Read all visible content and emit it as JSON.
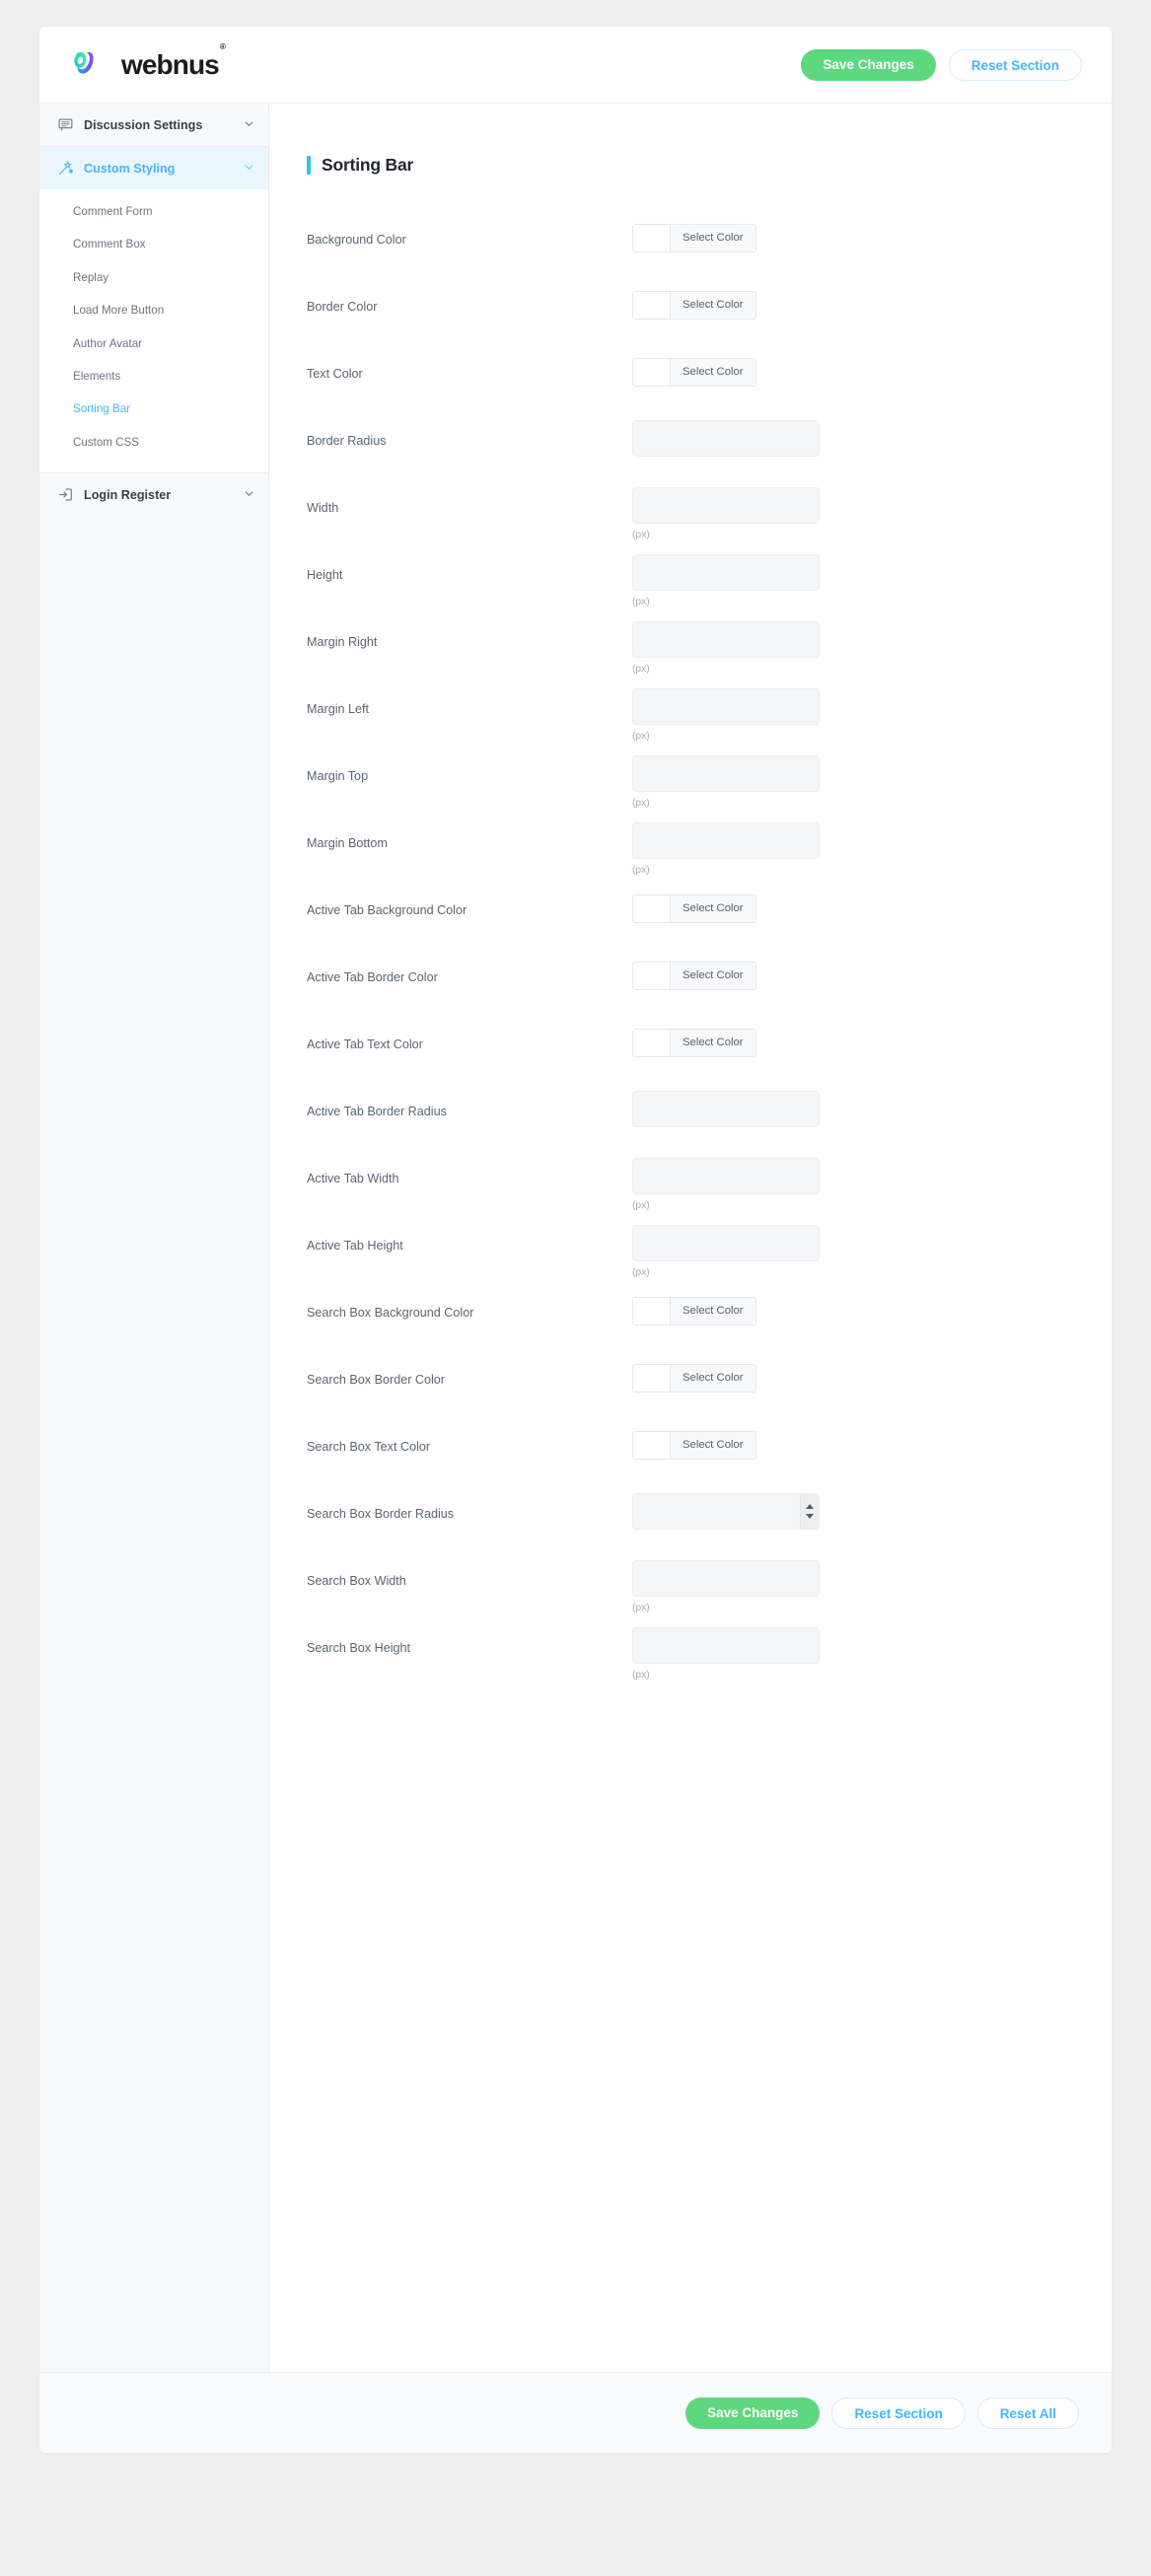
{
  "header": {
    "brand_name": "webnus",
    "brand_mark_icon": "webnus-logo-icon",
    "registered_mark": "®",
    "save_label": "Save Changes",
    "reset_section_label": "Reset Section"
  },
  "sidebar": {
    "groups": [
      {
        "label": "Discussion Settings",
        "icon": "comment-icon",
        "active": false,
        "items": []
      },
      {
        "label": "Custom Styling",
        "icon": "magic-wand-icon",
        "active": true,
        "items": [
          {
            "label": "Comment Form",
            "active": false
          },
          {
            "label": "Comment Box",
            "active": false
          },
          {
            "label": "Replay",
            "active": false
          },
          {
            "label": "Load More Button",
            "active": false
          },
          {
            "label": "Author Avatar",
            "active": false
          },
          {
            "label": "Elements",
            "active": false
          },
          {
            "label": "Sorting Bar",
            "active": true
          },
          {
            "label": "Custom CSS",
            "active": false
          }
        ]
      },
      {
        "label": "Login Register",
        "icon": "login-icon",
        "active": false,
        "items": []
      }
    ]
  },
  "main": {
    "section_title": "Sorting Bar",
    "accent_color": "#2ec3ef",
    "color_button_label": "Select Color",
    "unit_label": "(px)",
    "input_value": "",
    "input_placeholder": "",
    "fields": [
      {
        "label": "Background Color",
        "type": "color"
      },
      {
        "label": "Border Color",
        "type": "color"
      },
      {
        "label": "Text Color",
        "type": "color"
      },
      {
        "label": "Border Radius",
        "type": "text"
      },
      {
        "label": "Width",
        "type": "text",
        "unit": "(px)"
      },
      {
        "label": "Height",
        "type": "text",
        "unit": "(px)"
      },
      {
        "label": "Margin Right",
        "type": "text",
        "unit": "(px)"
      },
      {
        "label": "Margin Left",
        "type": "text",
        "unit": "(px)"
      },
      {
        "label": "Margin Top",
        "type": "text",
        "unit": "(px)"
      },
      {
        "label": "Margin Bottom",
        "type": "text",
        "unit": "(px)"
      },
      {
        "label": "Active Tab Background Color",
        "type": "color"
      },
      {
        "label": "Active Tab Border Color",
        "type": "color"
      },
      {
        "label": "Active Tab Text Color",
        "type": "color"
      },
      {
        "label": "Active Tab Border Radius",
        "type": "text"
      },
      {
        "label": "Active Tab Width",
        "type": "text",
        "unit": "(px)"
      },
      {
        "label": "Active Tab Height",
        "type": "text",
        "unit": "(px)"
      },
      {
        "label": "Search Box Background Color",
        "type": "color"
      },
      {
        "label": "Search Box Border Color",
        "type": "color"
      },
      {
        "label": "Search Box Text Color",
        "type": "color"
      },
      {
        "label": "Search Box Border Radius",
        "type": "number"
      },
      {
        "label": "Search Box Width",
        "type": "text",
        "unit": "(px)"
      },
      {
        "label": "Search Box Height",
        "type": "text",
        "unit": "(px)"
      }
    ]
  },
  "footer": {
    "save_label": "Save Changes",
    "reset_section_label": "Reset Section",
    "reset_all_label": "Reset All"
  },
  "colors": {
    "save_green": "#5ed87f",
    "link_blue": "#45b5f5",
    "accent_cyan": "#2ec3ef",
    "page_bg": "#efefef"
  }
}
